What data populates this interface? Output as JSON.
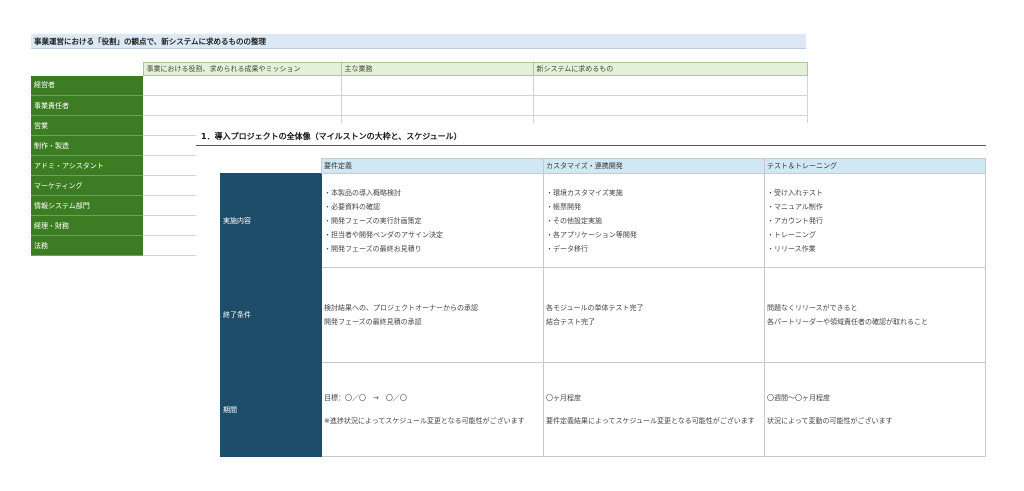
{
  "sheet1": {
    "title": "事業運営における「役割」の観点で、新システムに求めるものの整理",
    "columns": [
      "事業における役割、求められる成果やミッション",
      "主な業務",
      "新システムに求めるもの"
    ],
    "roles": [
      "経営者",
      "事業責任者",
      "営業",
      "制作・製造",
      "アドミ・アシスタント",
      "マーケティング",
      "情報システム部門",
      "経理・財務",
      "法務"
    ]
  },
  "sheet2": {
    "title": "1．導入プロジェクトの全体像（マイルストンの大枠と、スケジュール）",
    "phases": [
      "要件定義",
      "カスタマイズ・連携開発",
      "テスト＆トレーニング"
    ],
    "rows": {
      "activities": {
        "label": "実施内容",
        "cells": [
          [
            "・本製品の導入概略検討",
            "・必要資料の確認",
            "・開発フェーズの実行計画策定",
            "・担当者や開発ベンダのアサイン決定",
            "・開発フェーズの最終お見積り"
          ],
          [
            "・環境カスタマイズ実施",
            "・帳票開発",
            "・その他設定実施",
            "・各アプリケーション等開発",
            "・データ移行"
          ],
          [
            "・受け入れテスト",
            "・マニュアル制作",
            "・アカウント発行",
            "・トレーニング",
            "・リリース作業"
          ]
        ]
      },
      "exit": {
        "label": "終了条件",
        "cells": [
          [
            "検討結果への、プロジェクトオーナーからの承認",
            "開発フェーズの最終見積の承認"
          ],
          [
            "各モジュールの単体テスト完了",
            "結合テスト完了"
          ],
          [
            "問題なくリリースができると",
            "各パートリーダーや領域責任者の確認が取れること"
          ]
        ]
      },
      "period": {
        "label": "期間",
        "cells": [
          [
            "目標：〇／〇　→　〇／〇",
            "※進捗状況によってスケジュール変更となる可能性がございます"
          ],
          [
            "〇ヶ月程度",
            "要件定義結果によってスケジュール変更となる可能性がございます"
          ],
          [
            "〇週間〜〇ヶ月程度",
            "状況によって変動の可能性がございます"
          ]
        ]
      }
    }
  }
}
